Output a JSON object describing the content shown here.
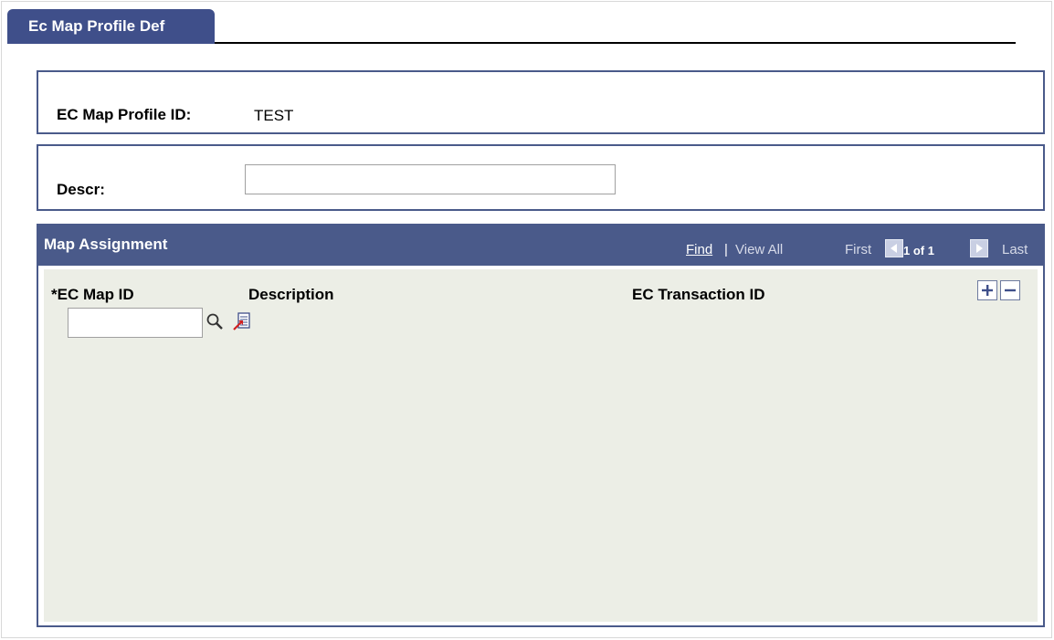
{
  "tab": {
    "label": "Ec Map Profile Def"
  },
  "profile": {
    "label": "EC Map Profile ID:",
    "value": "TEST"
  },
  "descr": {
    "label": "Descr:",
    "value": ""
  },
  "grid": {
    "title": "Map Assignment",
    "nav": {
      "find": "Find",
      "separator": "|",
      "view_all": "View All",
      "first": "First",
      "count": "1 of 1",
      "last": "Last"
    },
    "columns": {
      "map_id": "*EC Map ID",
      "description": "Description",
      "transaction_id": "EC Transaction ID"
    },
    "row": {
      "map_id": "",
      "description": "",
      "transaction_id": ""
    }
  },
  "icons": {
    "prev": "arrow-left-icon",
    "next": "arrow-right-icon",
    "lookup": "magnifier-icon",
    "detail": "detail-page-icon",
    "add": "plus-icon",
    "delete": "minus-icon"
  },
  "colors": {
    "tab_bg": "#3f4f8a",
    "grid_header": "#4a5a8a",
    "grid_body": "#eceee6"
  }
}
